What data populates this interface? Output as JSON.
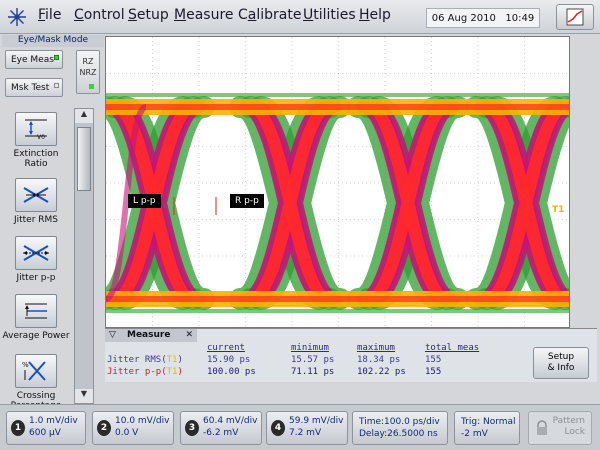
{
  "menu": {
    "items": [
      {
        "label": "File",
        "accel": "F"
      },
      {
        "label": "Control",
        "accel": "C"
      },
      {
        "label": "Setup",
        "accel": "S"
      },
      {
        "label": "Measure",
        "accel": "M"
      },
      {
        "label": "Calibrate",
        "accel": "a"
      },
      {
        "label": "Utilities",
        "accel": "U"
      },
      {
        "label": "Help",
        "accel": "H"
      }
    ],
    "date": "06 Aug 2010",
    "time": "10:49"
  },
  "left_panel": {
    "mode_label": "Eye/Mask Mode",
    "eye_meas_label": "Eye Meas",
    "msk_test_label": "Msk Test",
    "rz_label": "RZ",
    "nrz_label": "NRZ",
    "tools": [
      {
        "label": "Extinction Ratio",
        "icon": "extinction-ratio-icon"
      },
      {
        "label": "Jitter RMS",
        "icon": "jitter-rms-icon"
      },
      {
        "label": "Jitter p-p",
        "icon": "jitter-pp-icon"
      },
      {
        "label": "Average Power",
        "icon": "average-power-icon"
      },
      {
        "label": "Crossing Percentage",
        "icon": "crossing-percentage-icon"
      }
    ],
    "scroll_position": 0.12
  },
  "display": {
    "left_marker": "L p-p",
    "right_marker": "R p-p",
    "trigger_marker": "T1",
    "colors": {
      "background": "#ffffff",
      "grid": "#c8c8c8",
      "outer": "#2f9e2f",
      "mid": "#c8127a",
      "inner": "#ff2a2a",
      "rail": "#ffb000"
    }
  },
  "measure": {
    "tab_label": "Measure",
    "columns": [
      "current",
      "minimum",
      "maximum",
      "total meas"
    ],
    "rows": [
      {
        "name": "Jitter RMS",
        "src": "T1",
        "current": "15.90 ps",
        "minimum": "15.57 ps",
        "maximum": "18.34 ps",
        "total": "155"
      },
      {
        "name": "Jitter p-p",
        "src": "T1",
        "current": "100.00 ps",
        "minimum": "71.11 ps",
        "maximum": "102.22 ps",
        "total": "155"
      }
    ],
    "setup_label_1": "Setup",
    "setup_label_2": "& Info"
  },
  "bottom": {
    "channels": [
      {
        "num": "1",
        "scale": "1.0 mV/div",
        "offset": "600 µV"
      },
      {
        "num": "2",
        "scale": "10.0 mV/div",
        "offset": "0.0 V"
      },
      {
        "num": "3",
        "scale": "60.4 mV/div",
        "offset": "-6.2 mV"
      },
      {
        "num": "4",
        "scale": "59.9 mV/div",
        "offset": "7.2 mV"
      }
    ],
    "time": "Time:100.0 ps/div",
    "delay": "Delay:26.5000 ns",
    "trig_mode": "Trig: Normal",
    "trig_level": "-2 mV",
    "pattern_1": "Pattern",
    "pattern_2": "Lock"
  }
}
